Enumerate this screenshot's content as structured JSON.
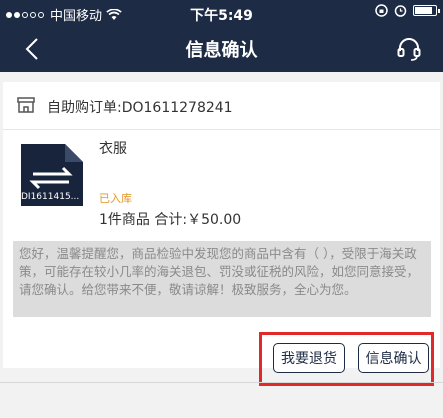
{
  "status_bar": {
    "carrier": "中国移动",
    "time": "下午5:49"
  },
  "nav": {
    "title": "信息确认"
  },
  "order": {
    "label": "自助购订单:DO1611278241"
  },
  "product": {
    "thumb_label": "DI1611415...",
    "name": "衣服",
    "status": "已入库",
    "total_text": "1件商品  合计:￥50.00"
  },
  "notice": {
    "text": "您好，温馨提醒您，商品检验中发现您的商品中含有（    ），受限于海关政策，可能存在较小几率的海关退包、罚没或征税的风险，如您同意接受，请您确认。给您带来不便，敬请谅解！极致服务，全心为您。"
  },
  "actions": {
    "return_label": "我要退货",
    "confirm_label": "信息确认"
  },
  "colors": {
    "header_bg": "#1e2b45",
    "status_orange": "#e39524",
    "highlight_red": "#e02a2a"
  },
  "icons": {
    "back": "chevron-left-icon",
    "service": "headset-icon",
    "store": "store-icon"
  }
}
